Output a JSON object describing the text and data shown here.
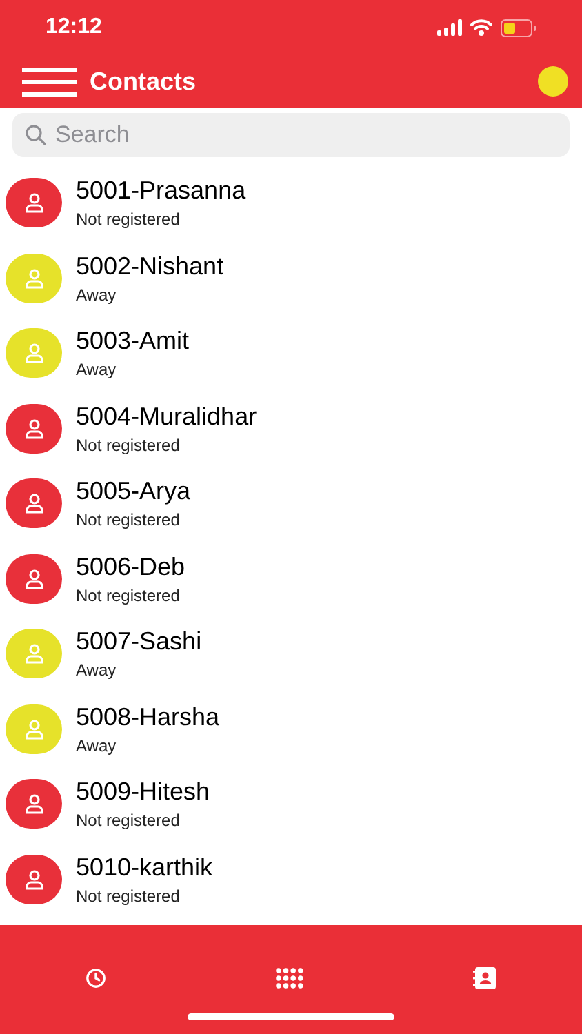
{
  "status_bar": {
    "time": "12:12"
  },
  "header": {
    "title": "Contacts",
    "status_dot": {
      "color": "#f0e024"
    }
  },
  "search": {
    "placeholder": "Search"
  },
  "contacts": [
    {
      "name": "5001-Prasanna",
      "status": "Not registered",
      "color": "#e8303a"
    },
    {
      "name": "5002-Nishant",
      "status": "Away",
      "color": "#e6e22a"
    },
    {
      "name": "5003-Amit",
      "status": "Away",
      "color": "#e6e22a"
    },
    {
      "name": "5004-Muralidhar",
      "status": "Not registered",
      "color": "#e8303a"
    },
    {
      "name": "5005-Arya",
      "status": "Not registered",
      "color": "#e8303a"
    },
    {
      "name": "5006-Deb",
      "status": "Not registered",
      "color": "#e8303a"
    },
    {
      "name": "5007-Sashi",
      "status": "Away",
      "color": "#e6e22a"
    },
    {
      "name": "5008-Harsha",
      "status": "Away",
      "color": "#e6e22a"
    },
    {
      "name": "5009-Hitesh",
      "status": "Not registered",
      "color": "#e8303a"
    },
    {
      "name": "5010-karthik",
      "status": "Not registered",
      "color": "#e8303a"
    }
  ]
}
